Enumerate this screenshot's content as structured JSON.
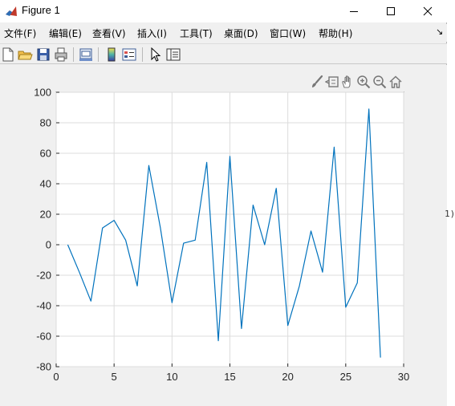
{
  "window": {
    "title": "Figure 1",
    "minimize_icon": "minimize-icon",
    "maximize_icon": "maximize-icon",
    "close_icon": "close-icon"
  },
  "menu": {
    "items": [
      {
        "label": "文件(F)"
      },
      {
        "label": "编辑(E)"
      },
      {
        "label": "查看(V)"
      },
      {
        "label": "插入(I)"
      },
      {
        "label": "工具(T)"
      },
      {
        "label": "桌面(D)"
      },
      {
        "label": "窗口(W)"
      },
      {
        "label": "帮助(H)"
      }
    ],
    "dock_arrow": "↘"
  },
  "toolbar": {
    "icons": [
      "new-figure-icon",
      "open-file-icon",
      "save-icon",
      "print-icon",
      "link-plot-icon",
      "colorbar-icon",
      "legend-icon",
      "pointer-icon",
      "property-inspector-icon"
    ]
  },
  "axes_toolbar": {
    "icons": [
      "brush-icon",
      "data-tips-icon",
      "pan-icon",
      "zoom-in-icon",
      "zoom-out-icon",
      "home-icon"
    ]
  },
  "side_text": "1)",
  "chart_data": {
    "type": "line",
    "x": [
      1,
      2,
      3,
      4,
      5,
      6,
      7,
      8,
      9,
      10,
      11,
      12,
      13,
      14,
      15,
      16,
      17,
      18,
      19,
      20,
      21,
      22,
      23,
      24,
      25,
      26,
      27,
      28
    ],
    "series": [
      {
        "values": [
          0,
          -18,
          -37,
          11,
          16,
          3,
          -27,
          52,
          11,
          -38,
          1,
          3,
          54,
          -63,
          58,
          -55,
          26,
          0,
          37,
          -53,
          -27,
          9,
          -18,
          64,
          -41,
          -25,
          89,
          -74
        ],
        "color": "#0072bd"
      }
    ],
    "xlim": [
      0,
      30
    ],
    "ylim": [
      -80,
      100
    ],
    "xticks": [
      0,
      5,
      10,
      15,
      20,
      25,
      30
    ],
    "xtick_labels": [
      "0",
      "5",
      "10",
      "15",
      "20",
      "25",
      "30"
    ],
    "yticks": [
      100,
      80,
      60,
      40,
      20,
      0,
      -20,
      -40,
      -60,
      -80
    ],
    "ytick_labels": [
      "100",
      "80",
      "60",
      "40",
      "20",
      "0",
      "-20",
      "-40",
      "-60",
      "-80"
    ],
    "grid": true,
    "title": "",
    "xlabel": "",
    "ylabel": ""
  }
}
